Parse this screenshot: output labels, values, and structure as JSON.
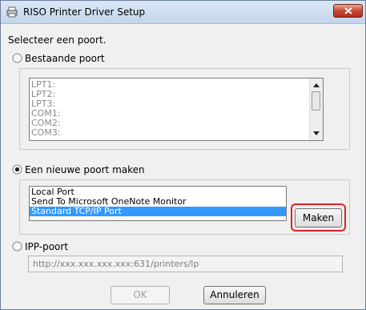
{
  "window": {
    "title": "RISO Printer Driver Setup"
  },
  "instruction": "Selecteer een poort.",
  "existing_port": {
    "label": "Bestaande poort",
    "selected": false,
    "items": [
      "LPT1:",
      "LPT2:",
      "LPT3:",
      "COM1:",
      "COM2:",
      "COM3:"
    ]
  },
  "new_port": {
    "label": "Een nieuwe poort maken",
    "selected": true,
    "items": [
      "Local Port",
      "Send To Microsoft OneNote Monitor",
      "Standard TCP/IP Port"
    ],
    "selected_item": "Standard TCP/IP Port",
    "make_button": "Maken"
  },
  "ipp_port": {
    "label": "IPP-poort",
    "selected": false,
    "url_placeholder": "http://xxx.xxx.xxx.xxx:631/printers/lp"
  },
  "footer": {
    "ok": "OK",
    "cancel": "Annuleren"
  },
  "colors": {
    "highlight": "#e0202a",
    "selection": "#3399ff",
    "close_button": "#c74a36"
  }
}
